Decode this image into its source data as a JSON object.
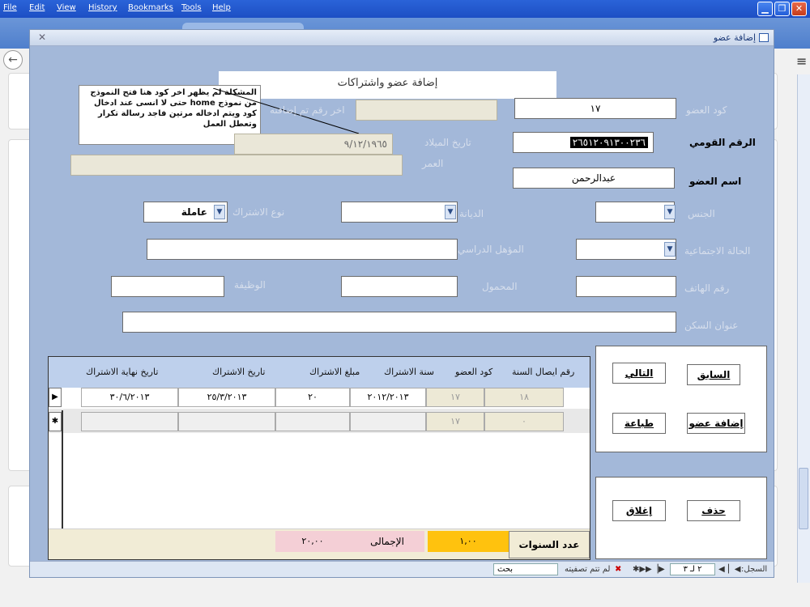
{
  "browser": {
    "menu": [
      "File",
      "Edit",
      "View",
      "History",
      "Bookmarks",
      "Tools",
      "Help"
    ]
  },
  "form": {
    "window_title": "إضافة عضو",
    "heading": "إضافة عضو واشتراكات",
    "note": "المشكلة لم يظهر اخر كود هنا فتح النموذج من نموذج home حتى لا انسى عند ادخال كود ويتم ادخاله مرتين فاجد رسالة تكرار وتعطل العمل",
    "fields": {
      "member_code": {
        "label": "كود العضو",
        "value": "١٧"
      },
      "last_added": {
        "label": "اخر رقم تم إضافته",
        "value": ""
      },
      "national_id": {
        "label": "الرقم القومي",
        "value": "٢٦٥١٢٠٩١٣٠٠٢٣٦"
      },
      "birth_date": {
        "label": "تاريخ الميلاد",
        "value": "٩/١٢/١٩٦٥"
      },
      "age": {
        "label": "العمر",
        "value": ""
      },
      "member_name": {
        "label": "اسم العضو",
        "value": "عبدالرحمن"
      },
      "gender": {
        "label": "الجنس",
        "value": ""
      },
      "religion": {
        "label": "الديانة",
        "value": ""
      },
      "subscription_type": {
        "label": "نوع الاشتراك",
        "value": "عاملة"
      },
      "marital_status": {
        "label": "الحالة الاجتماعية",
        "value": ""
      },
      "qualification": {
        "label": "المؤهل الدراسي",
        "value": ""
      },
      "phone": {
        "label": "رقم الهاتف",
        "value": ""
      },
      "mobile": {
        "label": "المحمول",
        "value": ""
      },
      "job": {
        "label": "الوظيفة",
        "value": ""
      },
      "address": {
        "label": "عنوان السكن",
        "value": ""
      }
    },
    "subform": {
      "columns": [
        "رقم ايصال السنة",
        "كود العضو",
        "سنة الاشتراك",
        "مبلغ الاشتراك",
        "تاريخ الاشتراك",
        "تاريخ نهاية الاشتراك"
      ],
      "rows": [
        {
          "receipt": "١٨",
          "code": "١٧",
          "year": "٢٠١٢/٢٠١٣",
          "amount": "٢٠",
          "date": "٢٥/٣/٢٠١٣",
          "end_date": "٣٠/٦/٢٠١٣"
        },
        {
          "receipt": "٠",
          "code": "١٧",
          "year": "",
          "amount": "",
          "date": "",
          "end_date": ""
        }
      ],
      "years_label": "عدد السنوات",
      "years_value": "١,٠٠",
      "total_label": "الإجمالى",
      "total_value": "٢٠,٠٠"
    },
    "buttons": {
      "previous": "السابق",
      "next": "التالي",
      "add_member": "إضافة عضو",
      "print": "طباعة",
      "delete": "حذف",
      "close": "إغلاق"
    },
    "status": {
      "record_label": "السجل:",
      "record_value": "٢ لـ ٣",
      "filter": "لم تتم تصفيته",
      "search": "بحث"
    }
  },
  "colors": {
    "form_bg": "#a3b8d9",
    "subform_header": "#bed0ec",
    "years_bg": "#ffc20e",
    "total_bg": "#f4cfd6"
  }
}
